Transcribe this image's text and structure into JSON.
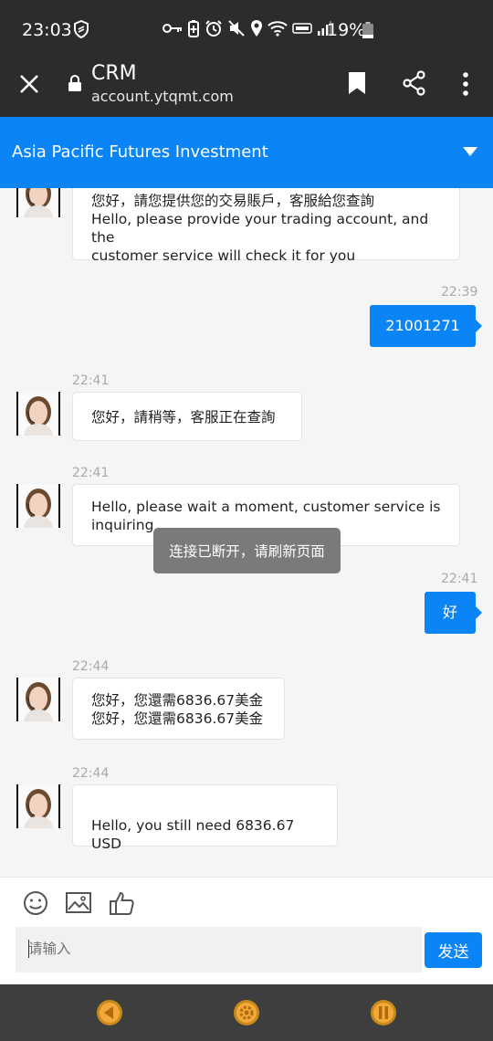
{
  "status_bar": {
    "time": "23:03",
    "battery": "19%"
  },
  "browser": {
    "title": "CRM",
    "url": "account.ytqmt.com"
  },
  "header": {
    "name": "Asia Pacific Futures Investment"
  },
  "messages": [
    {
      "side": "in",
      "time": "",
      "line1": "您好，請您提供您的交易賬戶，客服給您查詢",
      "line2": "Hello, please provide your trading account, and the",
      "line3": "customer service will check it for you"
    },
    {
      "side": "out",
      "time": "22:39",
      "text": "21001271"
    },
    {
      "side": "in",
      "time": "22:41",
      "text": "您好，請稍等，客服正在查詢"
    },
    {
      "side": "in",
      "time": "22:41",
      "line1": "Hello, please wait a moment, customer service is",
      "line2": "inquiring"
    },
    {
      "side": "out",
      "time": "22:41",
      "text": "好"
    },
    {
      "side": "in",
      "time": "22:44",
      "line1": "您好，您還需6836.67美金",
      "line2": "您好，您還需6836.67美金"
    },
    {
      "side": "in",
      "time": "22:44",
      "text": "Hello, you still need 6836.67 USD"
    }
  ],
  "toast": "连接已断开，请刷新页面",
  "input": {
    "placeholder": "请输入",
    "send_label": "发送"
  },
  "colors": {
    "primary": "#0b85f5",
    "dark_bar": "#2c2c2c"
  }
}
